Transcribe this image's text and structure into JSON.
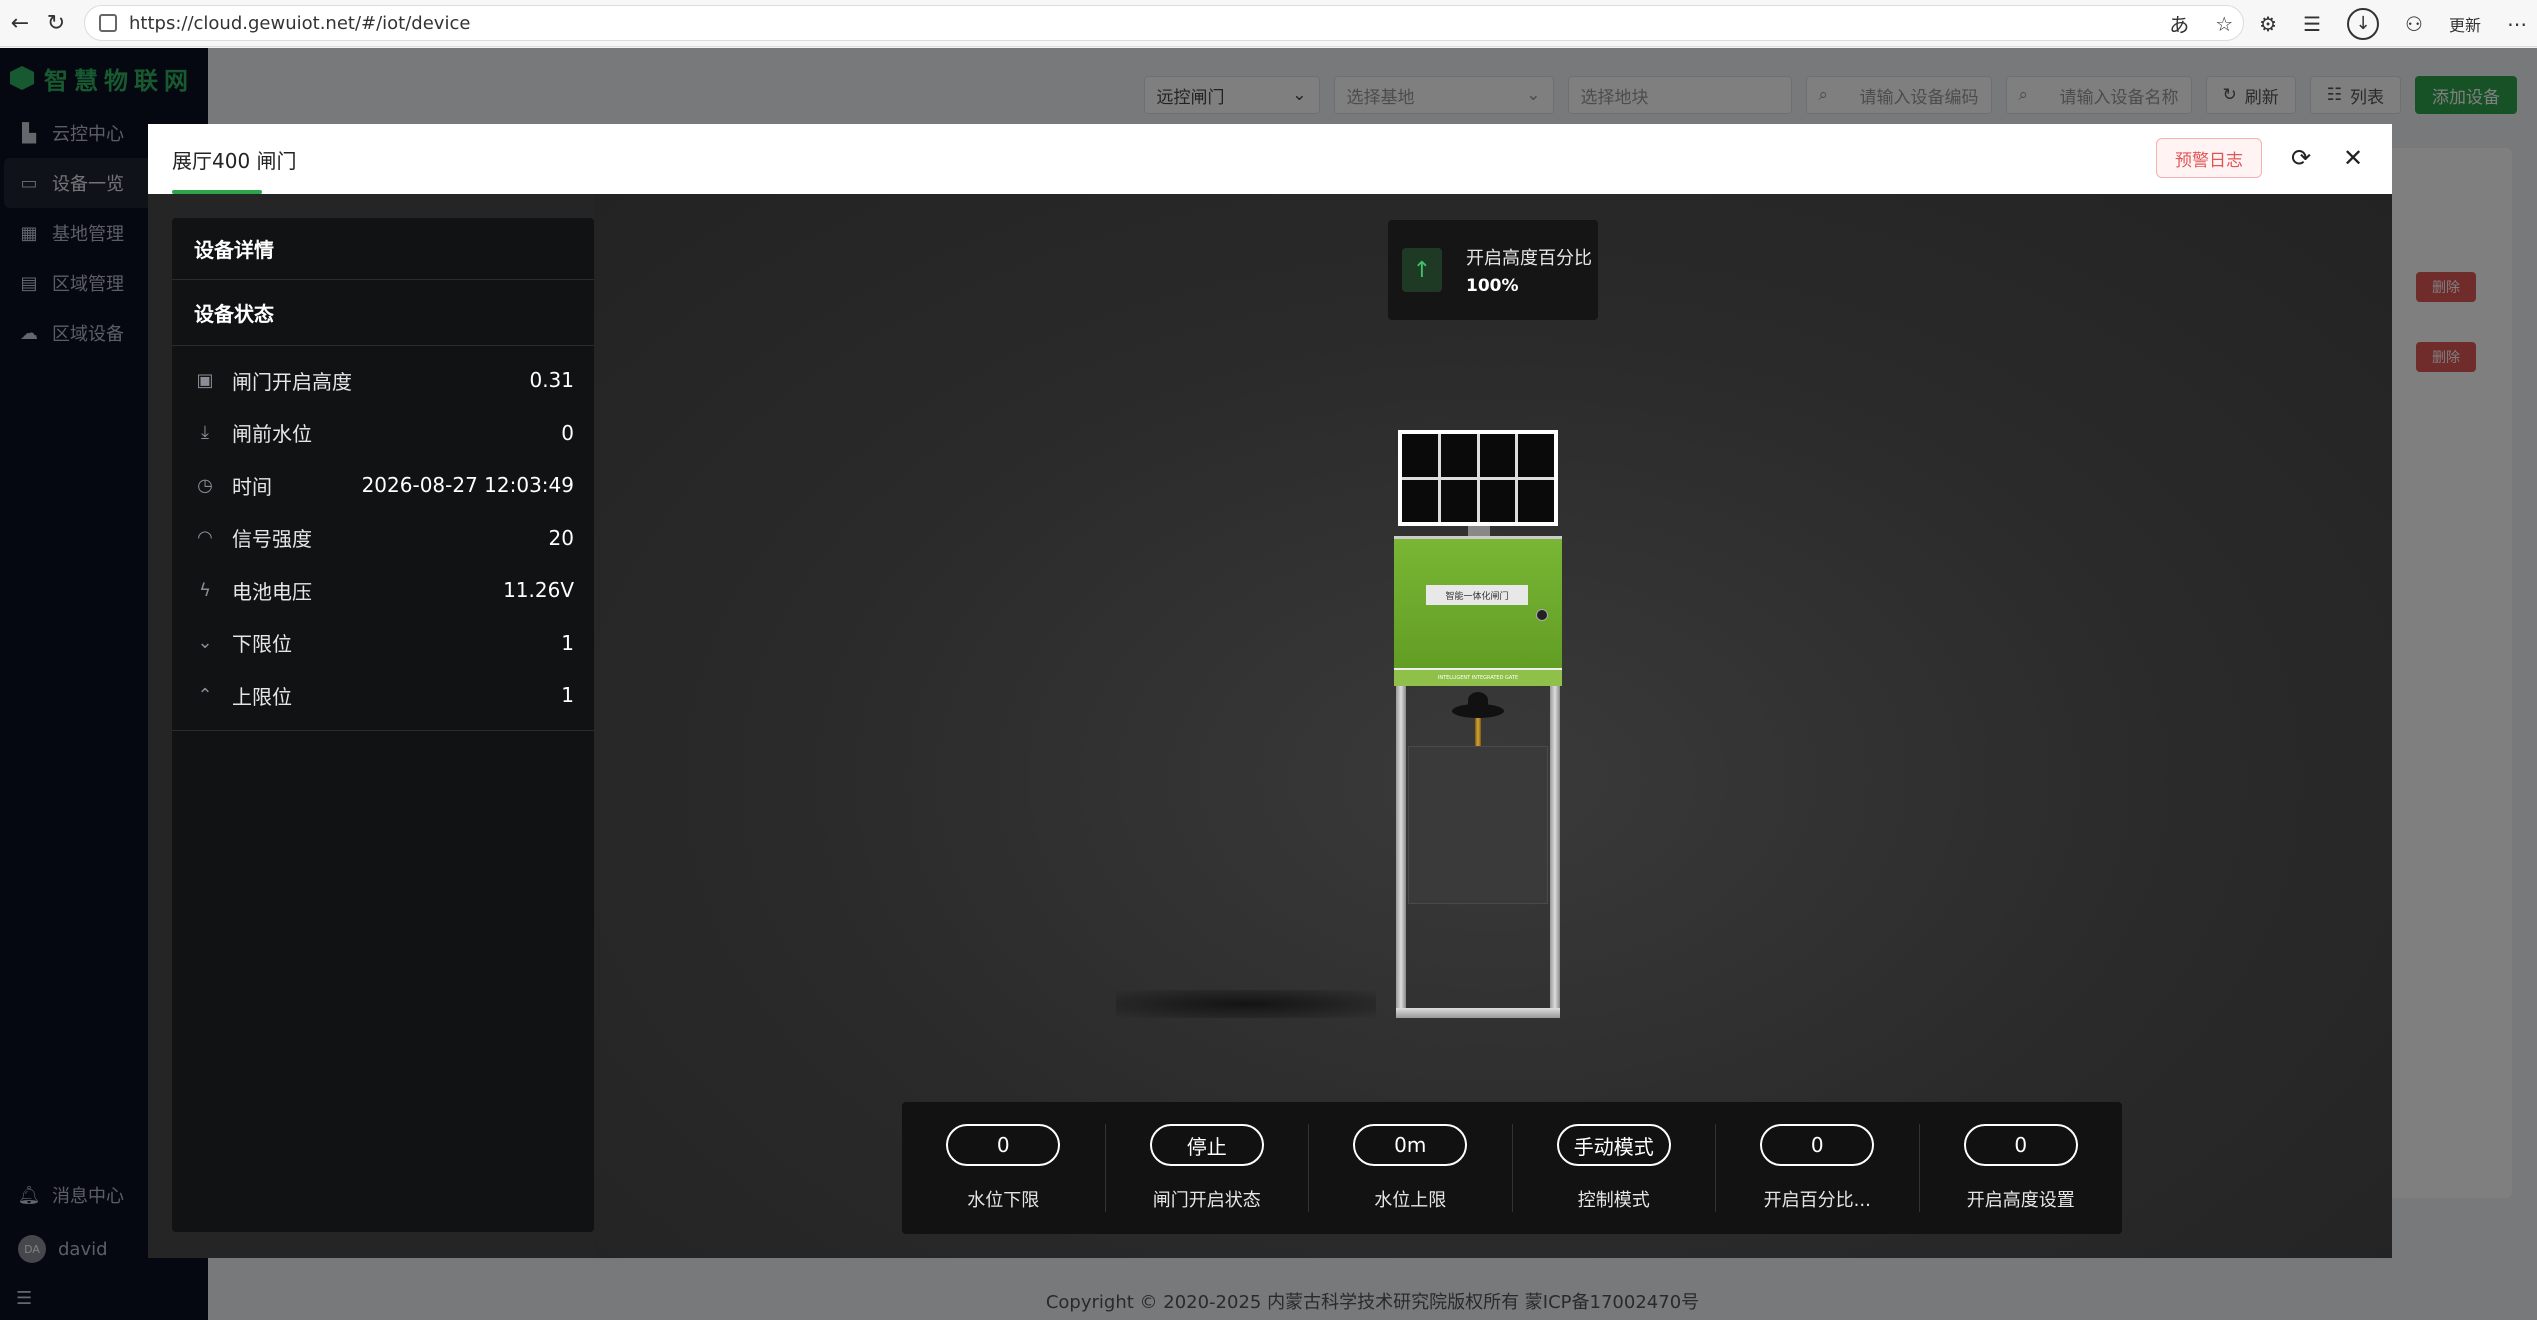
{
  "browser": {
    "url": "https://cloud.gewuiot.net/#/iot/device",
    "update_label": "更新"
  },
  "sidebar": {
    "logo": "智慧物联网",
    "items": [
      {
        "label": "云控中心",
        "icon": "building-icon"
      },
      {
        "label": "设备一览",
        "icon": "device-icon",
        "active": true
      },
      {
        "label": "基地管理",
        "icon": "office-icon"
      },
      {
        "label": "区域管理",
        "icon": "area-icon"
      },
      {
        "label": "区域设备",
        "icon": "cloud-device-icon"
      }
    ],
    "message_center": "消息中心",
    "user": "david"
  },
  "toolbar": {
    "type_select": "远控闸门",
    "base_placeholder": "选择基地",
    "plot_placeholder": "选择地块",
    "code_placeholder": "请输入设备编码",
    "name_placeholder": "请输入设备名称",
    "refresh": "刷新",
    "list": "列表",
    "add": "添加设备"
  },
  "table": {
    "delete_label": "删除"
  },
  "footer": {
    "copyright": "Copyright © 2020-2025 内蒙古科学技术研究院版权所有 蒙ICP备17002470号"
  },
  "modal": {
    "title": "展厅400 闸门",
    "warning_log": "预警日志",
    "details_title": "设备详情",
    "status_title": "设备状态",
    "status": [
      {
        "label": "闸门开启高度",
        "value": "0.31",
        "icon": "monitor-icon"
      },
      {
        "label": "闸前水位",
        "value": "0",
        "icon": "download-icon"
      },
      {
        "label": "时间",
        "value": "2026-08-27 12:03:49",
        "icon": "clock-icon"
      },
      {
        "label": "信号强度",
        "value": "20",
        "icon": "wifi-icon"
      },
      {
        "label": "电池电压",
        "value": "11.26V",
        "icon": "lightning-icon"
      },
      {
        "label": "下限位",
        "value": "1",
        "icon": "chevron-down-icon"
      },
      {
        "label": "上限位",
        "value": "1",
        "icon": "chevron-up-icon"
      }
    ],
    "badge": {
      "label": "开启高度百分比",
      "value": "100%"
    },
    "gate_sign": "智能一体化闸门",
    "gate_strip": "INTELLIGENT INTEGRATED GATE",
    "controls": [
      {
        "value": "0",
        "label": "水位下限"
      },
      {
        "value": "停止",
        "label": "闸门开启状态"
      },
      {
        "value": "0m",
        "label": "水位上限"
      },
      {
        "value": "手动模式",
        "label": "控制模式"
      },
      {
        "value": "0",
        "label": "开启百分比..."
      },
      {
        "value": "0",
        "label": "开启高度设置"
      }
    ]
  }
}
